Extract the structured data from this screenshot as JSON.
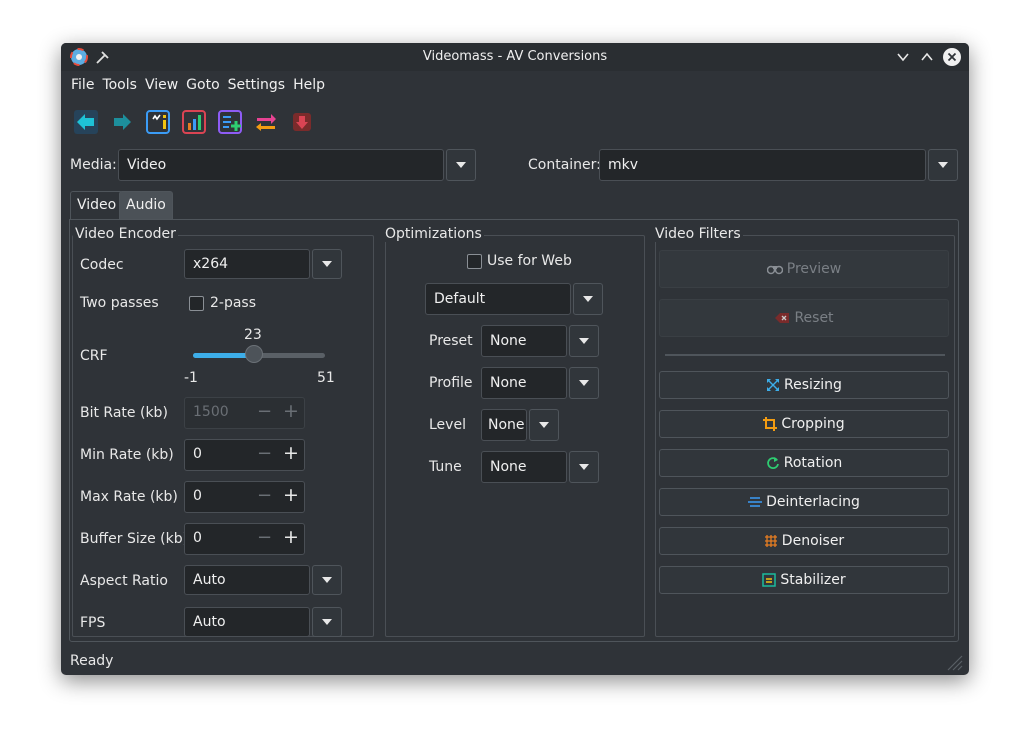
{
  "window": {
    "title": "Videomass - AV Conversions"
  },
  "menu": [
    "File",
    "Tools",
    "View",
    "Goto",
    "Settings",
    "Help"
  ],
  "toolbar": [
    {
      "icon": "back-arrow-icon",
      "color": "#1ec2d6"
    },
    {
      "icon": "forward-arrow-icon",
      "color": "#22a3b1"
    },
    {
      "icon": "info-icon",
      "color": "#3b9cf6"
    },
    {
      "icon": "stats-chart-icon",
      "color": "#e67e22"
    },
    {
      "icon": "add-queue-icon",
      "color": "#8e5cf5"
    },
    {
      "icon": "swap-icon",
      "color": "#f39c12"
    },
    {
      "icon": "stop-icon",
      "color": "#da4453"
    }
  ],
  "media": {
    "label": "Media:",
    "value": "Video"
  },
  "container": {
    "label": "Container:",
    "value": "mkv"
  },
  "tabs": [
    "Video",
    "Audio"
  ],
  "encoder": {
    "title": "Video Encoder",
    "codec_label": "Codec",
    "codec_value": "x264",
    "twopass_label": "Two passes",
    "twopass_check": "2-pass",
    "crf_label": "CRF",
    "crf_value": "23",
    "crf_min": "-1",
    "crf_max": "51",
    "crf_fraction": 0.46,
    "bitrate_label": "Bit Rate (kb)",
    "bitrate_value": "1500",
    "minrate_label": "Min Rate (kb)",
    "minrate_value": "0",
    "maxrate_label": "Max Rate (kb)",
    "maxrate_value": "0",
    "buffer_label": "Buffer Size (kb)",
    "buffer_value": "0",
    "aspect_label": "Aspect Ratio",
    "aspect_value": "Auto",
    "fps_label": "FPS",
    "fps_value": "Auto"
  },
  "optimizations": {
    "title": "Optimizations",
    "web_label": "Use for Web",
    "profile_select": "Default",
    "preset_label": "Preset",
    "preset_value": "None",
    "profile_label": "Profile",
    "profile_value": "None",
    "level_label": "Level",
    "level_value": "None",
    "tune_label": "Tune",
    "tune_value": "None"
  },
  "filters": {
    "title": "Video Filters",
    "preview": "Preview",
    "reset": "Reset",
    "resizing": "Resizing",
    "cropping": "Cropping",
    "rotation": "Rotation",
    "deinterlacing": "Deinterlacing",
    "denoiser": "Denoiser",
    "stabilizer": "Stabilizer"
  },
  "status": "Ready",
  "colors": {
    "window_bg": "#2f3338",
    "field_bg": "#232629",
    "accent": "#3daee9"
  }
}
